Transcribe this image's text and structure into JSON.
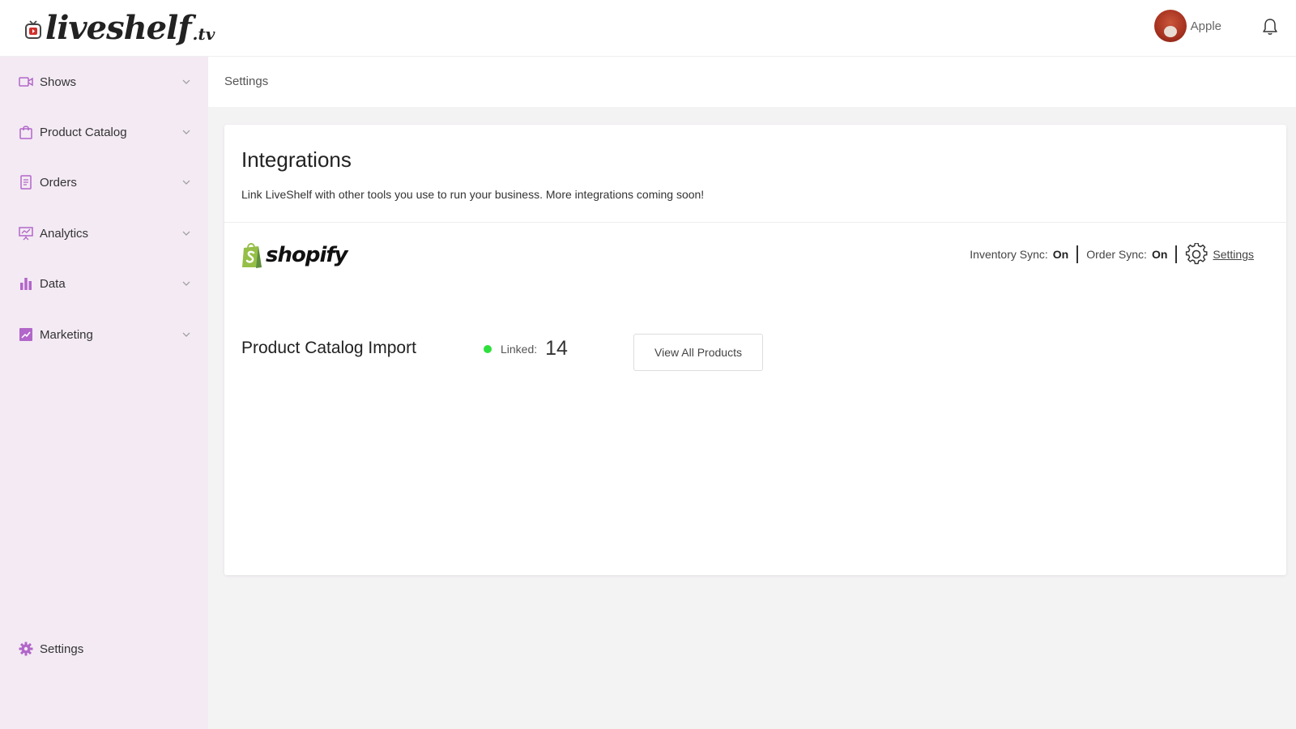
{
  "app": {
    "logo_text": "liveshelf",
    "logo_suffix": ".tv"
  },
  "user": {
    "name": "Apple"
  },
  "sidebar": {
    "items": [
      {
        "label": "Shows",
        "icon": "video-icon"
      },
      {
        "label": "Product Catalog",
        "icon": "shopping-bag-icon"
      },
      {
        "label": "Orders",
        "icon": "document-icon"
      },
      {
        "label": "Analytics",
        "icon": "presentation-chart-icon"
      },
      {
        "label": "Data",
        "icon": "bar-chart-icon"
      },
      {
        "label": "Marketing",
        "icon": "trend-chart-icon"
      }
    ],
    "settings_label": "Settings"
  },
  "breadcrumb": "Settings",
  "integrations": {
    "title": "Integrations",
    "description": "Link LiveShelf with other tools you use to run your business. More integrations coming soon!",
    "shopify": {
      "wordmark": "shopify",
      "inventory_sync_label": "Inventory Sync:",
      "inventory_sync_value": "On",
      "order_sync_label": "Order Sync:",
      "order_sync_value": "On",
      "settings_link": "Settings"
    },
    "catalog_import": {
      "title": "Product Catalog Import",
      "linked_label": "Linked:",
      "linked_count": "14",
      "view_button": "View All Products"
    }
  },
  "colors": {
    "sidebar_bg": "#f3eaf3",
    "accent": "#b266c9",
    "linked_dot": "#2ee03c",
    "shopify_green": "#95bf47"
  }
}
